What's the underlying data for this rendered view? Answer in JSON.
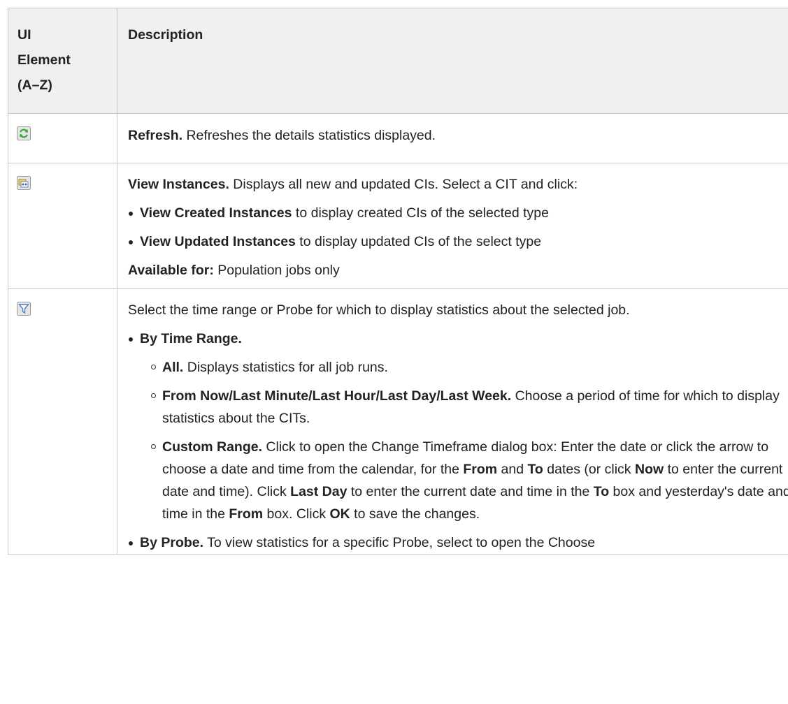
{
  "header": {
    "col1_line1": "UI",
    "col1_line2": "Element",
    "col1_line3": "(A–Z)",
    "col2": "Description"
  },
  "rows": {
    "refresh": {
      "icon": "refresh-icon",
      "title": "Refresh.",
      "text": " Refreshes the details statistics displayed."
    },
    "view_instances": {
      "icon": "view-instances-icon",
      "title": "View Instances.",
      "text": " Displays all new and updated CIs. Select a CIT and click:",
      "bullets": [
        {
          "bold": "View Created Instances",
          "text": " to display created CIs of the selected type"
        },
        {
          "bold": "View Updated Instances",
          "text": " to display updated CIs of the select type"
        }
      ],
      "avail_label": "Available for:",
      "avail_text": " Population jobs only"
    },
    "filter": {
      "icon": "filter-icon",
      "intro": "Select the time range or Probe for which to display statistics about the selected job.",
      "by_time_range": "By Time Range.",
      "all_label": "All.",
      "all_text": " Displays statistics for all job runs.",
      "from_now_label": "From Now/Last Minute/Last Hour/Last Day/Last Week.",
      "from_now_text": " Choose a period of time for which to display statistics about the CITs.",
      "custom": {
        "label": "Custom Range.",
        "t1": " Click to open the Change Timeframe dialog box: Enter the date or click the arrow to choose a date and time from the calendar, for the ",
        "from": "From",
        "t2": " and ",
        "to": "To",
        "t3": " dates (or click ",
        "now": "Now",
        "t4": " to enter the current date and time). Click ",
        "last_day": "Last Day",
        "t5": " to enter the current date and time in the ",
        "to2": "To",
        "t6": " box and yesterday's date and time in the ",
        "from2": "From",
        "t7": " box. Click ",
        "ok": "OK",
        "t8": " to save the changes."
      },
      "by_probe_label": "By Probe.",
      "by_probe_text": " To view statistics for a specific Probe, select to open the Choose"
    }
  },
  "colors": {
    "header_bg": "#f0f0f0",
    "border": "#c8c8c8",
    "text": "#222222",
    "refresh_green": "#3aa53a",
    "filter_blue": "#4a7fc0"
  }
}
